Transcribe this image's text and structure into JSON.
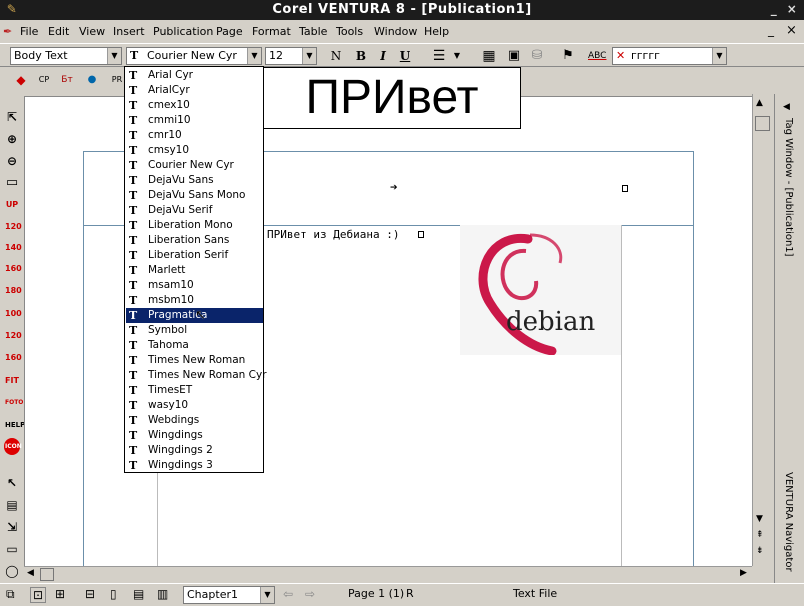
{
  "window": {
    "title": "Corel VENTURA 8 - [Publication1]",
    "minimize": "_",
    "close": "×",
    "doc_minimize": "_",
    "doc_close": "×"
  },
  "menu": {
    "items": [
      "File",
      "Edit",
      "View",
      "Insert",
      "Publication",
      "Page",
      "Format",
      "Table",
      "Tools",
      "Window",
      "Help"
    ]
  },
  "toolbar": {
    "style_value": "Body Text",
    "font_value": "Courier New Cyr",
    "size_value": "12",
    "normal_label": "N",
    "bold_label": "B",
    "italic_label": "I",
    "underline_label": "U",
    "spell_label": "ABC",
    "language_value": "ггггг"
  },
  "font_dropdown": {
    "fonts": [
      "Arial Cyr",
      "ArialCyr",
      "cmex10",
      "cmmi10",
      "cmr10",
      "cmsy10",
      "Courier New Cyr",
      "DejaVu Sans",
      "DejaVu Sans Mono",
      "DejaVu Serif",
      "Liberation Mono",
      "Liberation Sans",
      "Liberation Serif",
      "Marlett",
      "msam10",
      "msbm10",
      "Pragmatica",
      "Symbol",
      "Tahoma",
      "Times New Roman",
      "Times New Roman Cyr",
      "TimesET",
      "wasy10",
      "Webdings",
      "Wingdings",
      "Wingdings 2",
      "Wingdings 3"
    ],
    "selected": "Pragmatica",
    "type_icon": "T"
  },
  "preview": {
    "text": "ПРИвет"
  },
  "document": {
    "body_text": "ПРИвет из Дебиана :)",
    "logo_text": "debian"
  },
  "left_tools": [
    "UP",
    "120",
    "140",
    "160",
    "180",
    "100",
    "120",
    "160",
    "FIT",
    "FOTO",
    "HELP",
    "ICON"
  ],
  "right_panel": {
    "tag_window": "Tag Window - [Publication1]",
    "navigator": "VENTURA Navigator"
  },
  "statusbar": {
    "chapter": "Chapter1",
    "page": "Page 1 (1)",
    "mode": "R",
    "text_file": "Text File"
  }
}
